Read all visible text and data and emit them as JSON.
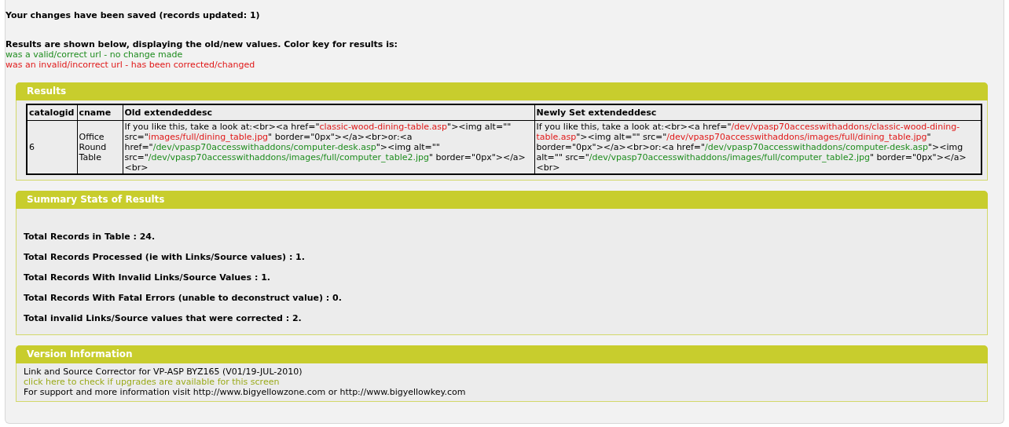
{
  "saved_message": "Your changes have been saved (records updated: 1)",
  "intro": "Results are shown below, displaying the old/new values. Color key for results is:",
  "color_key": [
    {
      "kind": "valid",
      "text": "was a valid/correct url - no change made"
    },
    {
      "kind": "invalid",
      "text": "was an invalid/incorrect url - has been corrected/changed"
    }
  ],
  "results": {
    "title": "Results",
    "table": {
      "columns": [
        "catalogid",
        "cname",
        "Old extendeddesc",
        "Newly Set extendeddesc"
      ],
      "rows": [
        {
          "cells": [
            [
              {
                "kind": "plain",
                "text": "6"
              }
            ],
            [
              {
                "kind": "plain",
                "text": "Office Round Table"
              }
            ],
            [
              {
                "kind": "plain",
                "text": "If you like this, take a look at:<br><a href=\""
              },
              {
                "kind": "invalid",
                "text": "classic-wood-dining-table.asp"
              },
              {
                "kind": "plain",
                "text": "\"><img alt=\"\" src=\""
              },
              {
                "kind": "invalid",
                "text": "images/full/dining_table.jpg"
              },
              {
                "kind": "plain",
                "text": "\" border=\"0px\"></a><br>or:<a href=\""
              },
              {
                "kind": "valid",
                "text": "/dev/vpasp70accesswithaddons/computer-desk.asp"
              },
              {
                "kind": "plain",
                "text": "\"><img alt=\"\" src=\""
              },
              {
                "kind": "valid",
                "text": "/dev/vpasp70accesswithaddons/images/full/computer_table2.jpg"
              },
              {
                "kind": "plain",
                "text": "\" border=\"0px\"></a><br>"
              }
            ],
            [
              {
                "kind": "plain",
                "text": "If you like this, take a look at:<br><a href=\""
              },
              {
                "kind": "invalid",
                "text": "/dev/vpasp70accesswithaddons/classic-wood-dining-table.asp"
              },
              {
                "kind": "plain",
                "text": "\"><img alt=\"\" src=\""
              },
              {
                "kind": "invalid",
                "text": "/dev/vpasp70accesswithaddons/images/full/dining_table.jpg"
              },
              {
                "kind": "plain",
                "text": "\" border=\"0px\"></a><br>or:<a href=\""
              },
              {
                "kind": "valid",
                "text": "/dev/vpasp70accesswithaddons/computer-desk.asp"
              },
              {
                "kind": "plain",
                "text": "\"><img alt=\"\" src=\""
              },
              {
                "kind": "valid",
                "text": "/dev/vpasp70accesswithaddons/images/full/computer_table2.jpg"
              },
              {
                "kind": "plain",
                "text": "\" border=\"0px\"></a><br>"
              }
            ]
          ]
        }
      ]
    }
  },
  "summary": {
    "title": "Summary Stats of Results",
    "stats": [
      "Total Records in Table : 24.",
      "Total Records Processed (ie with Links/Source values) : 1.",
      "Total Records With Invalid Links/Source Values : 1.",
      "Total Records With Fatal Errors (unable to deconstruct value) : 0.",
      "Total invalid Links/Source values that were corrected : 2."
    ]
  },
  "version": {
    "title": "Version Information",
    "product": "Link and Source Corrector for VP-ASP BYZ165 (V01/19-JUL-2010)",
    "upgrade_link": "click here to check if upgrades are available for this screen",
    "support": "For support and more information visit http://www.bigyellowzone.com or http://www.bigyellowkey.com"
  }
}
